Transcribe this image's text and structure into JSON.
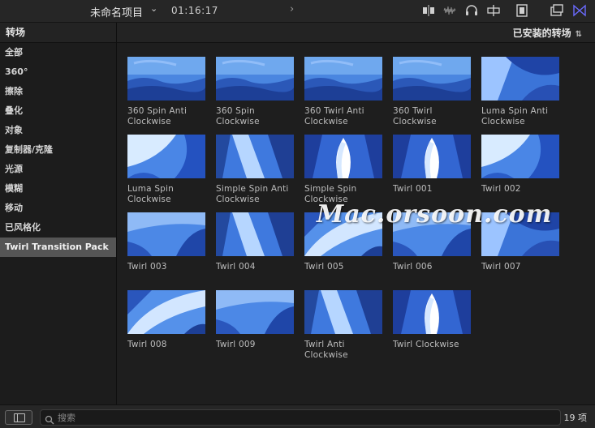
{
  "toolbar": {
    "project_title": "未命名项目",
    "timecode": "01:16:17"
  },
  "sidebar": {
    "header": "转场",
    "items": [
      {
        "label": "全部"
      },
      {
        "label": "360°"
      },
      {
        "label": "擦除"
      },
      {
        "label": "叠化"
      },
      {
        "label": "对象"
      },
      {
        "label": "复制器/克隆"
      },
      {
        "label": "光源"
      },
      {
        "label": "模糊"
      },
      {
        "label": "移动"
      },
      {
        "label": "已风格化"
      },
      {
        "label": "Twirl Transition Pack",
        "selected": true
      }
    ]
  },
  "content": {
    "category_label": "已安装的转场",
    "tiles": [
      {
        "label": "360 Spin Anti Clockwise",
        "thumb": "landscape"
      },
      {
        "label": "360 Spin Clockwise",
        "thumb": "landscape"
      },
      {
        "label": "360 Twirl Anti Clockwise",
        "thumb": "landscape"
      },
      {
        "label": "360 Twirl Clockwise",
        "thumb": "landscape"
      },
      {
        "label": "Luma Spin Anti Clockwise",
        "thumb": "swirl-a"
      },
      {
        "label": "Luma Spin Clockwise",
        "thumb": "swirl-b"
      },
      {
        "label": "Simple Spin Anti Clockwise",
        "thumb": "swirl-c"
      },
      {
        "label": "Simple Spin Clockwise",
        "thumb": "flame"
      },
      {
        "label": "Twirl 001",
        "thumb": "flame"
      },
      {
        "label": "Twirl 002",
        "thumb": "swirl-b"
      },
      {
        "label": "Twirl 003",
        "thumb": "swirl-d"
      },
      {
        "label": "Twirl 004",
        "thumb": "swirl-c"
      },
      {
        "label": "Twirl 005",
        "thumb": "swirl-e"
      },
      {
        "label": "Twirl 006",
        "thumb": "swirl-d"
      },
      {
        "label": "Twirl 007",
        "thumb": "swirl-a"
      },
      {
        "label": "Twirl 008",
        "thumb": "swirl-e"
      },
      {
        "label": "Twirl 009",
        "thumb": "swirl-d"
      },
      {
        "label": "Twirl Anti Clockwise",
        "thumb": "swirl-c"
      },
      {
        "label": "Twirl Clockwise",
        "thumb": "flame"
      }
    ]
  },
  "watermark": "Mac.orsoon.com",
  "search": {
    "placeholder": "搜索",
    "value": ""
  },
  "status": {
    "item_count": "19 项"
  },
  "colors": {
    "accent": "#6b6bff",
    "selected_row": "#555555",
    "thumb_blue": "#2d5fc8"
  },
  "icons": {
    "toolbar": [
      "chevron-down-icon",
      "nav-back-icon",
      "nav-forward-icon",
      "skimming-icon",
      "audio-skimming-icon",
      "headphones-icon",
      "snapping-icon",
      "filmstrip-icon",
      "window-layout-icon",
      "effects-browser-icon"
    ],
    "bottom": [
      "sidebar-toggle-icon",
      "search-icon"
    ]
  }
}
